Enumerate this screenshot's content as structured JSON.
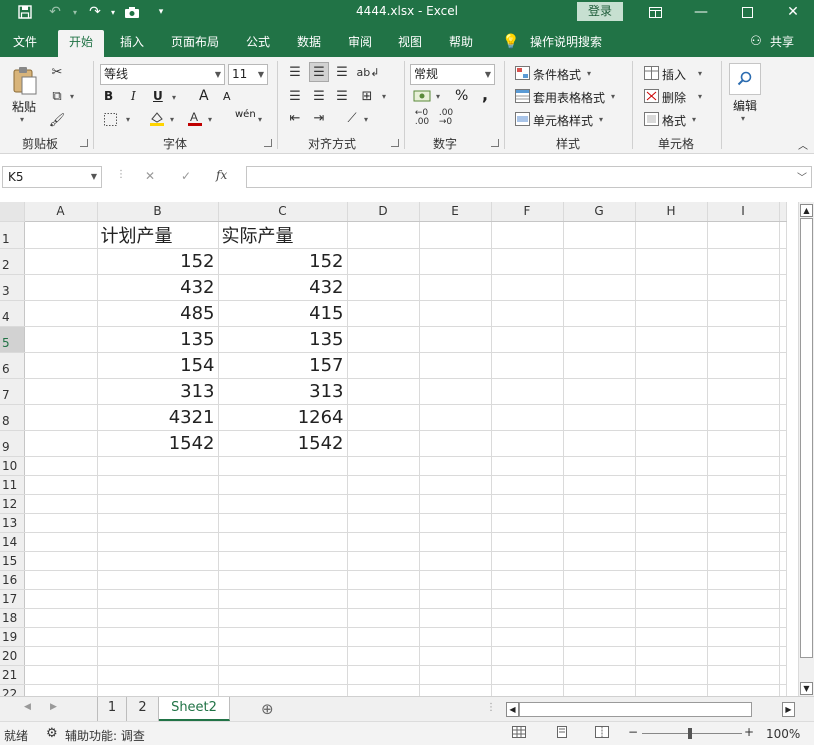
{
  "titlebar": {
    "title": "4444.xlsx  -  Excel",
    "login": "登录",
    "save_icon": "save-icon",
    "undo_icon": "undo-icon",
    "redo_icon": "redo-icon",
    "camera_icon": "camera-icon",
    "customize_icon": "customize-quick-access-icon"
  },
  "tabs": [
    "文件",
    "开始",
    "插入",
    "页面布局",
    "公式",
    "数据",
    "审阅",
    "视图",
    "帮助"
  ],
  "active_tab": "开始",
  "tell_me": "操作说明搜索",
  "share": "共享",
  "ribbon": {
    "clipboard": {
      "paste": "粘贴",
      "label": "剪贴板"
    },
    "font": {
      "name": "等线",
      "size": "11",
      "label": "字体",
      "bold": "B",
      "italic": "I",
      "underline": "U",
      "grow": "A",
      "shrink": "A",
      "phonetic": "wén"
    },
    "alignment": {
      "label": "对齐方式"
    },
    "number": {
      "format": "常规",
      "label": "数字",
      "percent": "%",
      "comma": ","
    },
    "styles": {
      "conditional": "条件格式",
      "table": "套用表格格式",
      "cell_styles": "单元格样式",
      "label": "样式"
    },
    "cells": {
      "insert": "插入",
      "delete": "删除",
      "format": "格式",
      "label": "单元格"
    },
    "editing": {
      "label": "编辑"
    }
  },
  "formula_bar": {
    "name_box": "K5",
    "cancel": "✕",
    "enter": "✓",
    "fx": "fx",
    "formula": ""
  },
  "grid": {
    "columns": [
      "A",
      "B",
      "C",
      "D",
      "E",
      "F",
      "G",
      "H",
      "I"
    ],
    "rows": [
      "1",
      "2",
      "3",
      "4",
      "5",
      "6",
      "7",
      "8",
      "9",
      "10",
      "11",
      "12",
      "13",
      "14",
      "15",
      "16",
      "17",
      "18",
      "19",
      "20",
      "21",
      "22"
    ],
    "selected_row": "5",
    "headers": {
      "B": "计划产量",
      "C": "实际产量"
    },
    "B": [
      "152",
      "432",
      "485",
      "135",
      "154",
      "313",
      "4321",
      "1542"
    ],
    "C": [
      "152",
      "432",
      "415",
      "135",
      "157",
      "313",
      "1264",
      "1542"
    ]
  },
  "sheets": [
    "1",
    "2",
    "Sheet2"
  ],
  "active_sheet": "Sheet2",
  "status": {
    "ready": "就绪",
    "accessibility": "辅助功能: 调查",
    "zoom": "100%",
    "minus": "−",
    "plus": "+"
  },
  "colors": {
    "accent": "#217346"
  }
}
